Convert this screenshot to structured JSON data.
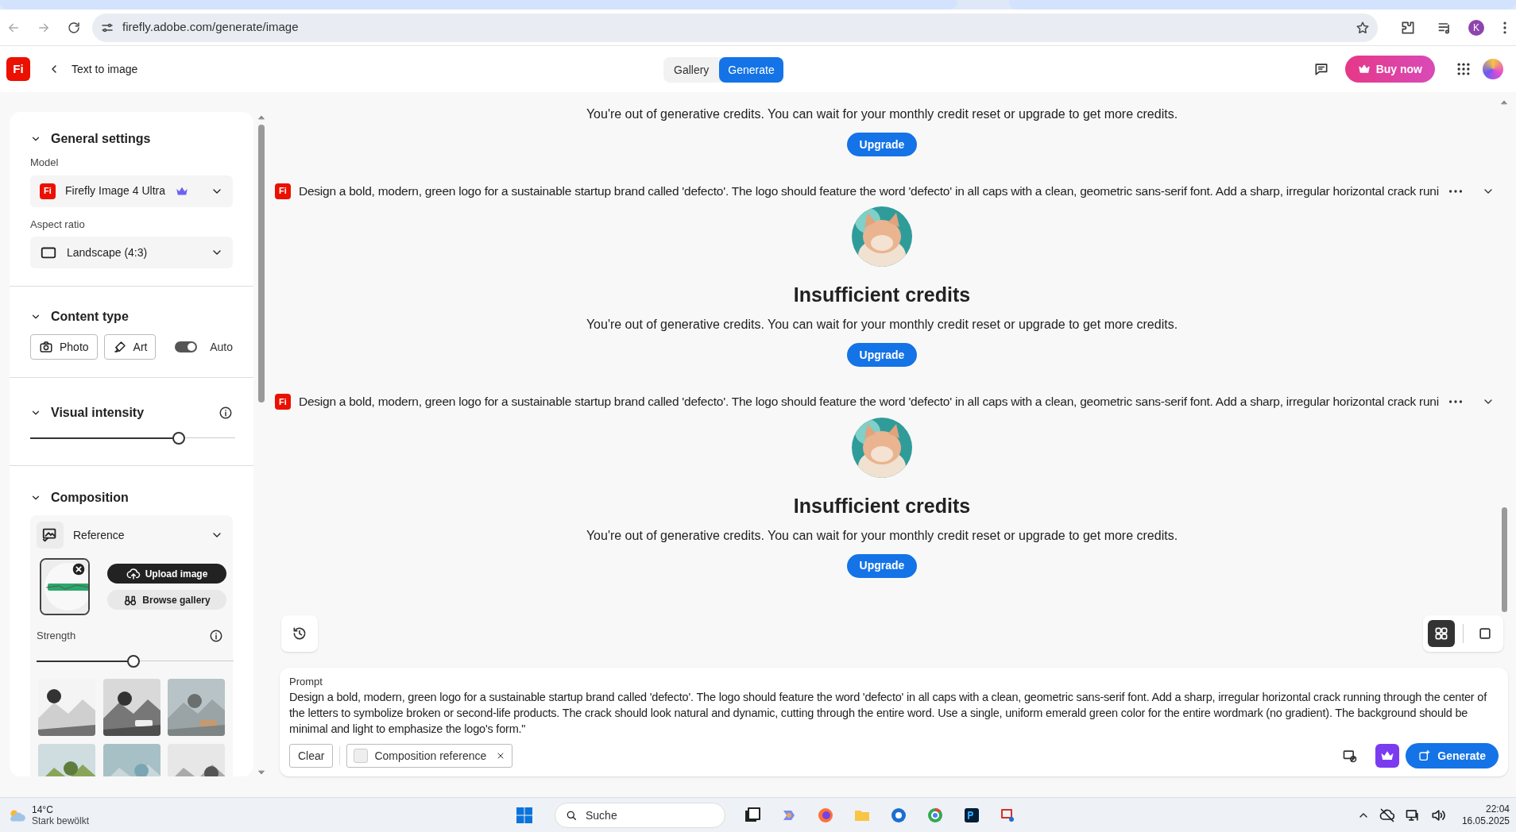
{
  "browser": {
    "url": "firefly.adobe.com/generate/image",
    "profile_initial": "K"
  },
  "header": {
    "logo": "Fi",
    "back_label": "Text to image",
    "tabs": [
      {
        "label": "Gallery",
        "selected": false
      },
      {
        "label": "Generate",
        "selected": true
      }
    ],
    "buy_button": "Buy now"
  },
  "sidebar": {
    "general": {
      "title": "General settings",
      "model_label": "Model",
      "model_logo": "Fi",
      "model": "Firefly Image 4 Ultra",
      "aspect_label": "Aspect ratio",
      "aspect": "Landscape (4:3)"
    },
    "content_type": {
      "title": "Content type",
      "options": [
        {
          "label": "Photo",
          "selected": false
        },
        {
          "label": "Art",
          "kind": "art",
          "selected": false
        }
      ],
      "auto": {
        "label": "Auto",
        "on": true
      }
    },
    "visual_intensity": {
      "title": "Visual intensity",
      "level": 0.74
    },
    "composition": {
      "title": "Composition",
      "reference": "Reference",
      "upload_button": "Upload image",
      "browse_button": "Browse gallery",
      "strength_label": "Strength",
      "strength": {
        "level": 0.49
      }
    }
  },
  "top_notice": {
    "message": "You're out of generative credits. You can wait for your monthly credit reset or upgrade to get more credits.",
    "button": "Upgrade"
  },
  "generations": [
    {
      "badge": "Fi",
      "prompt": "Design a bold, modern, green logo for a sustainable startup brand called 'defecto'. The logo should feature the word 'defecto' in all caps with a clean, geometric sans-serif font. Add a sharp, irregular horizontal crack runi",
      "title": "Insufficient credits",
      "message": "You're out of generative credits. You can wait for your monthly credit reset or upgrade to get more credits.",
      "button": "Upgrade"
    },
    {
      "badge": "Fi",
      "prompt": "Design a bold, modern, green logo for a sustainable startup brand called 'defecto'. The logo should feature the word 'defecto' in all caps with a clean, geometric sans-serif font. Add a sharp, irregular horizontal crack runi",
      "title": "Insufficient credits",
      "message": "You're out of generative credits. You can wait for your monthly credit reset or upgrade to get more credits.",
      "button": "Upgrade"
    }
  ],
  "view_modes": [
    {
      "kind": "grid",
      "selected": true
    },
    {
      "kind": "single",
      "selected": false
    }
  ],
  "prompt_box": {
    "label": "Prompt",
    "text": "Design a bold, modern, green logo for a sustainable startup brand called 'defecto'. The logo should feature the word 'defecto' in all caps with a clean, geometric sans-serif font. Add a sharp, irregular horizontal crack running through the center of the letters to symbolize broken or second-life products. The crack should look natural and dynamic, cutting through the entire word. Use a single, uniform emerald green color for the entire wordmark (no gradient). The background should be minimal and light to emphasize the logo's form.\"",
    "clear_button": "Clear",
    "chip": "Composition reference",
    "generate_button": "Generate"
  },
  "taskbar": {
    "temperature": "14°C",
    "weather": "Stark bewölkt",
    "search": "Suche",
    "time": "22:04",
    "date": "16.05.2025"
  }
}
